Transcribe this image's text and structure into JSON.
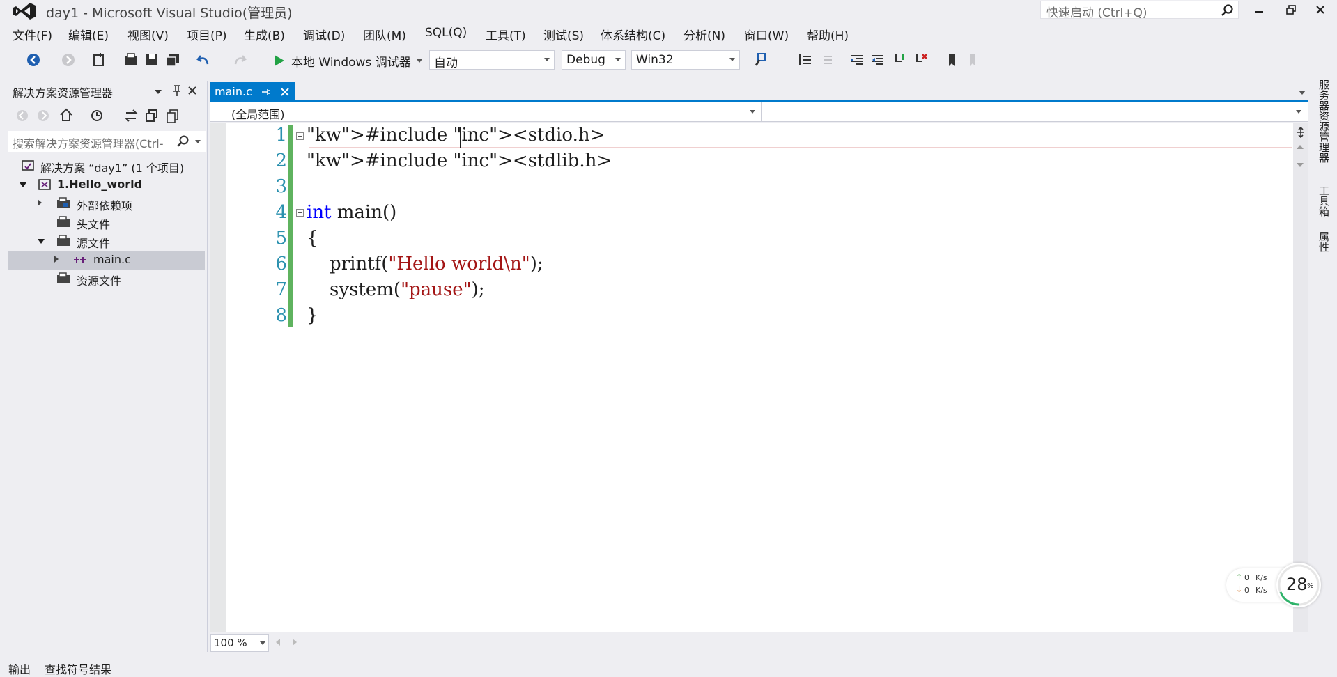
{
  "window": {
    "title": "day1 - Microsoft Visual Studio(管理员)",
    "quick_launch_placeholder": "快速启动 (Ctrl+Q)"
  },
  "menu": [
    "文件(F)",
    "编辑(E)",
    "视图(V)",
    "项目(P)",
    "生成(B)",
    "调试(D)",
    "团队(M)",
    "SQL(Q)",
    "工具(T)",
    "测试(S)",
    "体系结构(C)",
    "分析(N)",
    "窗口(W)",
    "帮助(H)"
  ],
  "toolbar": {
    "run_label": "本地 Windows 调试器",
    "solution_config_combo": "自动",
    "build_config": "Debug",
    "platform": "Win32"
  },
  "solution_explorer": {
    "title": "解决方案资源管理器",
    "search_placeholder": "搜索解决方案资源管理器(Ctrl-",
    "items": [
      {
        "label": "解决方案 “day1” (1 个项目)"
      },
      {
        "label": "1.Hello_world"
      },
      {
        "label": "外部依赖项"
      },
      {
        "label": "头文件"
      },
      {
        "label": "源文件"
      },
      {
        "label": "main.c"
      },
      {
        "label": "资源文件"
      }
    ]
  },
  "editor": {
    "tab_label": "main.c",
    "scope": "(全局范围)",
    "zoom": "100 %",
    "lines": [
      {
        "num": "1",
        "text": "#include <stdio.h>"
      },
      {
        "num": "2",
        "text": "#include <stdlib.h>"
      },
      {
        "num": "3",
        "text": ""
      },
      {
        "num": "4",
        "text": "int main()"
      },
      {
        "num": "5",
        "text": "{"
      },
      {
        "num": "6",
        "text": "    printf(\"Hello world\\n\");"
      },
      {
        "num": "7",
        "text": "    system(\"pause\");"
      },
      {
        "num": "8",
        "text": "}"
      }
    ]
  },
  "side_tabs": [
    "服务器资源管理器",
    "工具箱",
    "属性"
  ],
  "bottom_tabs": [
    "输出",
    "查找符号结果"
  ],
  "net_widget": {
    "up": "0",
    "down": "0",
    "unit": "K/s",
    "percent": "28",
    "percent_sign": "%"
  }
}
